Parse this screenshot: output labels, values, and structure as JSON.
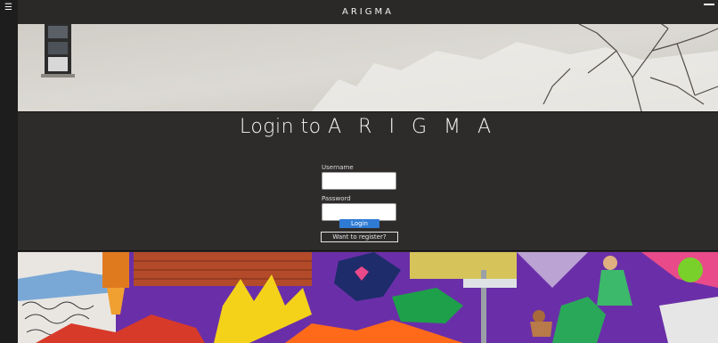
{
  "header": {
    "brand": "ARIGMA"
  },
  "login": {
    "title_prefix": "Login to",
    "title_brand": "A R I G M A",
    "username_label": "Username",
    "username_value": "",
    "password_label": "Password",
    "password_value": "",
    "login_button": "Login",
    "register_button": "Want to register?"
  },
  "colors": {
    "background": "#2e2b2b",
    "login_button": "#2f7bd4"
  },
  "icons": {
    "menu": "hamburger-icon",
    "window": "minimize-icon"
  }
}
